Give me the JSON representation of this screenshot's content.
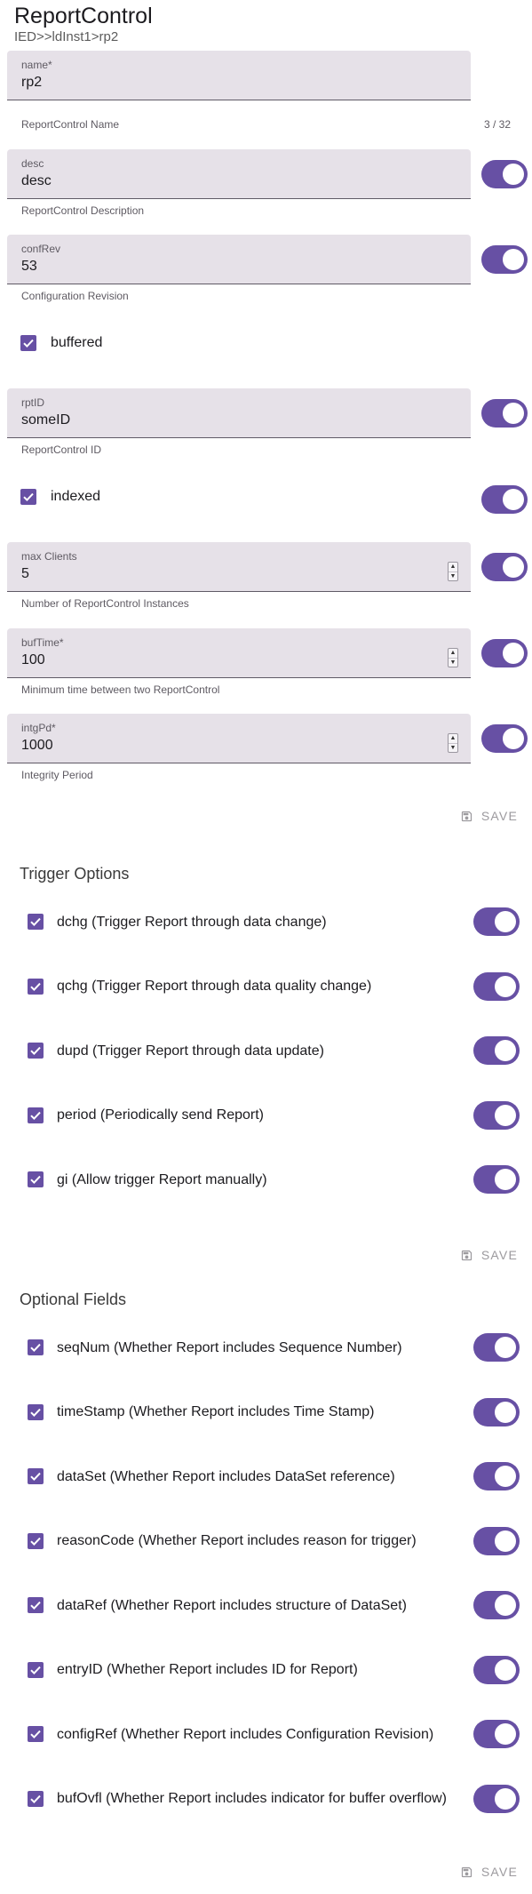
{
  "header": {
    "title": "ReportControl",
    "breadcrumb": "IED>>ldInst1>rp2"
  },
  "fields": {
    "name": {
      "label": "name*",
      "value": "rp2",
      "helper": "ReportControl Name",
      "counter": "3 / 32"
    },
    "desc": {
      "label": "desc",
      "value": "desc",
      "helper": "ReportControl Description"
    },
    "confRev": {
      "label": "confRev",
      "value": "53",
      "helper": "Configuration Revision"
    },
    "buffered": {
      "label": "buffered"
    },
    "rptID": {
      "label": "rptID",
      "value": "someID",
      "helper": "ReportControl ID"
    },
    "indexed": {
      "label": "indexed"
    },
    "maxClients": {
      "label": "max Clients",
      "value": "5",
      "helper": "Number of ReportControl Instances"
    },
    "bufTime": {
      "label": "bufTime*",
      "value": "100",
      "helper": "Minimum time between two ReportControl"
    },
    "intgPd": {
      "label": "intgPd*",
      "value": "1000",
      "helper": "Integrity Period"
    }
  },
  "save_label": "SAVE",
  "icons": {
    "spinner_up": "▲",
    "spinner_down": "▼"
  },
  "trigger_options": {
    "title": "Trigger Options",
    "items": [
      "dchg (Trigger Report through data change)",
      "qchg (Trigger Report through data quality change)",
      "dupd (Trigger Report through data update)",
      "period (Periodically send Report)",
      "gi (Allow trigger Report manually)"
    ]
  },
  "optional_fields": {
    "title": "Optional Fields",
    "items": [
      "seqNum (Whether Report includes Sequence Number)",
      "timeStamp (Whether Report includes Time Stamp)",
      "dataSet (Whether Report includes DataSet reference)",
      "reasonCode (Whether Report includes reason for trigger)",
      "dataRef (Whether Report includes structure of DataSet)",
      "entryID (Whether Report includes ID for Report)",
      "configRef (Whether Report includes Configuration Revision)",
      "bufOvfl (Whether Report includes indicator for buffer overflow)"
    ]
  },
  "colors": {
    "accent": "#6750a4",
    "field_bg": "#e6e1e8"
  }
}
